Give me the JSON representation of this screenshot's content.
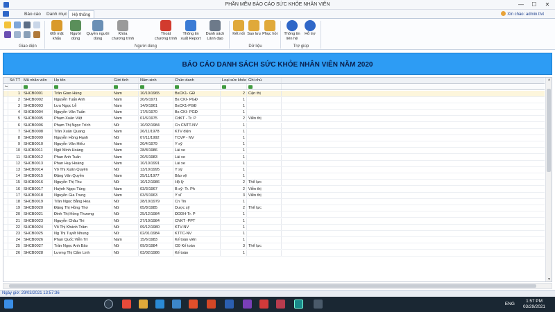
{
  "window": {
    "title": "PHẦN MỀM BÁO CÁO SỨC KHỎE NHÂN VIÊN",
    "minimize": "—",
    "maximize": "☐",
    "close": "✕"
  },
  "menu": {
    "tabs": [
      "Báo cáo",
      "Danh mục",
      "Hệ thống"
    ],
    "active_tab": "Hệ thống",
    "greeting": "Xin chào: admin.ttvt"
  },
  "ribbon": {
    "groups": [
      {
        "label": "Giao diện"
      },
      {
        "label": "Người dùng"
      },
      {
        "label": "Dữ liệu"
      },
      {
        "label": "Trợ giúp"
      }
    ],
    "buttons": [
      {
        "label": "Đổi mật khẩu",
        "icon": "key-icon",
        "color": "#d99a2b"
      },
      {
        "label": "Người dùng",
        "icon": "user-icon",
        "color": "#5a8f5a"
      },
      {
        "label": "Quyền người dùng",
        "icon": "users-icon",
        "color": "#6a8fb5"
      },
      {
        "label": "Khóa chương trình",
        "icon": "lock-icon",
        "color": "#9a9a9a"
      },
      {
        "label": "Thoát chương trình",
        "icon": "exit-icon",
        "color": "#d23b2e"
      },
      {
        "label": "Thông tin xuất Report",
        "icon": "report-icon",
        "color": "#3a7bd5"
      },
      {
        "label": "Danh sách Lãnh đạo",
        "icon": "leader-list-icon",
        "color": "#6d7a8a"
      },
      {
        "label": "Kết nối",
        "icon": "database-connect-icon",
        "color": "#e0a93a"
      },
      {
        "label": "Sao lưu",
        "icon": "database-backup-icon",
        "color": "#e0a93a"
      },
      {
        "label": "Phục hồi",
        "icon": "database-restore-icon",
        "color": "#e0a93a"
      },
      {
        "label": "Thông tin liên hệ",
        "icon": "info-icon",
        "color": "#2f67c8"
      },
      {
        "label": "Hỗ trợ",
        "icon": "help-icon",
        "color": "#2f67c8"
      }
    ]
  },
  "report": {
    "title": "BÁO CÁO DANH SÁCH SỨC KHỎE NHÂN VIÊN NĂM 2020"
  },
  "table": {
    "columns": [
      "Số TT",
      "Mã nhân viên",
      "Họ tên",
      "Giới tính",
      "Năm sinh",
      "Chức danh",
      "Loại sức khỏe",
      "Ghi chú"
    ],
    "rows": [
      [
        "1",
        "SHCB0001",
        "Trần Giao Hùng",
        "Nam",
        "10/10/1965",
        "BsCK1- GĐ",
        "2",
        "Cận thị"
      ],
      [
        "2",
        "SHCB0002",
        "Nguyễn Tuấn Anh",
        "Nam",
        "20/6/1971",
        "Bs CKI- PGĐ",
        "1",
        ""
      ],
      [
        "3",
        "SHCB0003",
        "Lưu Ngọc Lễ",
        "Nam",
        "14/9/1961",
        "BsCK1-PGĐ",
        "1",
        ""
      ],
      [
        "4",
        "SHCB0004",
        "Nguyễn Văn Tuấn",
        "Nam",
        "17/5/1970",
        "Bs CKI- PGĐ",
        "1",
        ""
      ],
      [
        "5",
        "SHCB0005",
        "Phạm Xuân Việt",
        "Nam",
        "01/6/1975",
        "CdKT - Tr. P",
        "2",
        "Viễn thị"
      ],
      [
        "6",
        "SHCB0006",
        "Phạm Thị Ngọc Trích",
        "Nữ",
        "10/02/1984",
        "Cn CNTT-NV",
        "1",
        ""
      ],
      [
        "7",
        "SHCB0008",
        "Trần Xuân Quang",
        "Nam",
        "26/11/1978",
        "KTV điện",
        "1",
        ""
      ],
      [
        "8",
        "SHCB0009",
        "Nguyễn Hồng Hạnh",
        "Nữ",
        "07/11/1992",
        "TCVP - NV",
        "1",
        ""
      ],
      [
        "9",
        "SHCB0010",
        "Nguyễn Văn Hiếu",
        "Nam",
        "20/4/1979",
        "Y sỹ",
        "1",
        ""
      ],
      [
        "10",
        "SHCB0011",
        "Ngô Minh Hoàng",
        "Nam",
        "28/8/1986",
        "Lái xe",
        "1",
        ""
      ],
      [
        "11",
        "SHCB0012",
        "Phan Anh Tuấn",
        "Nam",
        "20/6/1983",
        "Lái xe",
        "1",
        ""
      ],
      [
        "12",
        "SHCB0013",
        "Phan Huy Hoàng",
        "Nam",
        "10/10/1991",
        "Lái xe",
        "1",
        ""
      ],
      [
        "13",
        "SHCB0014",
        "Võ Thị Xuân Quyên",
        "Nữ",
        "13/10/1995",
        "Y sỹ",
        "1",
        ""
      ],
      [
        "14",
        "SHCB0015",
        "Đặng Văn Quyền",
        "Nam",
        "25/11/1977",
        "Bảo vệ",
        "1",
        ""
      ],
      [
        "15",
        "SHCB0016",
        "Nguyễn Thị Thu",
        "Nữ",
        "10/12/1986",
        "Hộ lý",
        "2",
        "Thể lực"
      ],
      [
        "16",
        "SHCB0017",
        "Huỳnh Ngọc Tùng",
        "Nam",
        "03/3/1967",
        "B sỹ- Tr. Ph",
        "2",
        "Viễn thị"
      ],
      [
        "17",
        "SHCB0018",
        "Nguyễn Gia Trung",
        "Nam",
        "03/3/1963",
        "Y sĩ",
        "3",
        "Viễn thị"
      ],
      [
        "18",
        "SHCB0019",
        "Trần Ngọc Bằng Hoa",
        "Nữ",
        "28/10/1979",
        "Cn Tin",
        "1",
        ""
      ],
      [
        "19",
        "SHCB0020",
        "Đặng Thị Hồng Thơ",
        "Nữ",
        "05/8/1985",
        "Dược sỹ",
        "2",
        "Thể lực"
      ],
      [
        "20",
        "SHCB0021",
        "Đinh Thị Hồng Thương",
        "Nữ",
        "25/12/1984",
        "ĐDDH-Tr. P",
        "1",
        ""
      ],
      [
        "21",
        "SHCB0023",
        "Nguyễn Châu Thi",
        "Nữ",
        "27/10/1984",
        "CNKT -PPT",
        "1",
        ""
      ],
      [
        "22",
        "SHCB0024",
        "Võ Thị Khánh Trâm",
        "Nữ",
        "09/12/1980",
        "KTV-NV",
        "1",
        ""
      ],
      [
        "23",
        "SHCB0025",
        "Ng Thị Tuyết Nhung",
        "Nữ",
        "02/01/1984",
        "KTTC-NV",
        "1",
        ""
      ],
      [
        "24",
        "SHCB0026",
        "Phan Quốc Viễn Trí",
        "Nam",
        "15/6/1983",
        "Kế toán viên",
        "1",
        ""
      ],
      [
        "25",
        "SHCB0027",
        "Trần Ngọc Anh Bảo",
        "Nữ",
        "09/3/1984",
        "CĐ Kế toán",
        "3",
        "Thể lực"
      ],
      [
        "26",
        "SHCB0028",
        "Lương Thị Cẩm Linh",
        "Nữ",
        "03/02/1986",
        "Kế toán",
        "1",
        ""
      ]
    ]
  },
  "status": {
    "login_time": "Ngày giờ: 29/03/2021 13:57:36"
  },
  "taskbar": {
    "language": "ENG",
    "time": "1:57 PM",
    "date": "03/29/2021"
  }
}
